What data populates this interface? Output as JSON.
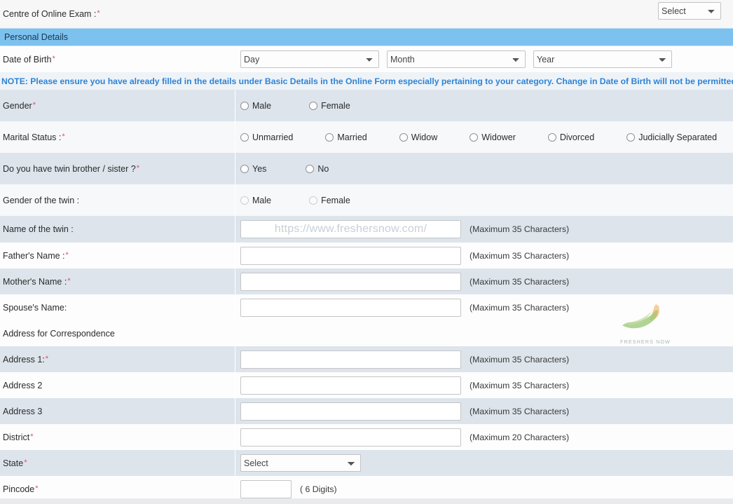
{
  "top": {
    "centre_label": "Centre of Online Exam :",
    "centre_required": "*",
    "centre_select_value": "Select"
  },
  "section": {
    "title": "Personal Details"
  },
  "dob": {
    "label": "Date of Birth",
    "required": "*",
    "day": "Day",
    "month": "Month",
    "year": "Year"
  },
  "note": {
    "text": "NOTE: Please ensure you have already filled in the details under Basic Details in the Online Form especially pertaining to your category. Change in Date of Birth will not be permitted",
    "color": "#2f83d4"
  },
  "gender": {
    "label": "Gender",
    "required": "*",
    "options": [
      "Male",
      "Female"
    ]
  },
  "marital": {
    "label": "Marital Status :",
    "required": "*",
    "options": [
      "Unmarried",
      "Married",
      "Widow",
      "Widower",
      "Divorced",
      "Judicially Separated"
    ]
  },
  "twin": {
    "label": "Do you have twin brother / sister ?",
    "required": "*",
    "options": [
      "Yes",
      "No"
    ]
  },
  "twin_gender": {
    "label": "Gender of the twin :",
    "options": [
      "Male",
      "Female"
    ]
  },
  "twin_name": {
    "label": "Name of the twin :",
    "value": "",
    "watermark": "https://www.freshersnow.com/",
    "hint": "(Maximum 35 Characters)"
  },
  "father": {
    "label": "Father's Name :",
    "required": "*",
    "value": "",
    "hint": "(Maximum 35 Characters)"
  },
  "mother": {
    "label": "Mother's Name :",
    "required": "*",
    "value": "",
    "hint": "(Maximum 35 Characters)"
  },
  "spouse": {
    "label": "Spouse's Name:",
    "value": "",
    "hint": "(Maximum 35 Characters)"
  },
  "address_heading": {
    "label": "Address for Correspondence"
  },
  "address1": {
    "label": "Address 1:",
    "required": "*",
    "value": "",
    "hint": "(Maximum 35 Characters)"
  },
  "address2": {
    "label": "Address 2",
    "value": "",
    "hint": "(Maximum 35 Characters)"
  },
  "address3": {
    "label": "Address 3",
    "value": "",
    "hint": "(Maximum 35 Characters)"
  },
  "district": {
    "label": "District",
    "required": "*",
    "value": "",
    "hint": "(Maximum 20 Characters)"
  },
  "state": {
    "label": "State",
    "required": "*",
    "select_value": "Select"
  },
  "pincode": {
    "label": "Pincode",
    "required": "*",
    "value": "",
    "hint": "( 6 Digits)"
  },
  "watermark_logo": {
    "caption": "FRESHERS NOW",
    "green": "#7ab648",
    "orange": "#f5a623"
  },
  "colors": {
    "section_header_bg": "#7dc1ef",
    "row_shade": "#dde4ec",
    "row_light": "#f7f8fa",
    "required_star": "#e8486c"
  }
}
